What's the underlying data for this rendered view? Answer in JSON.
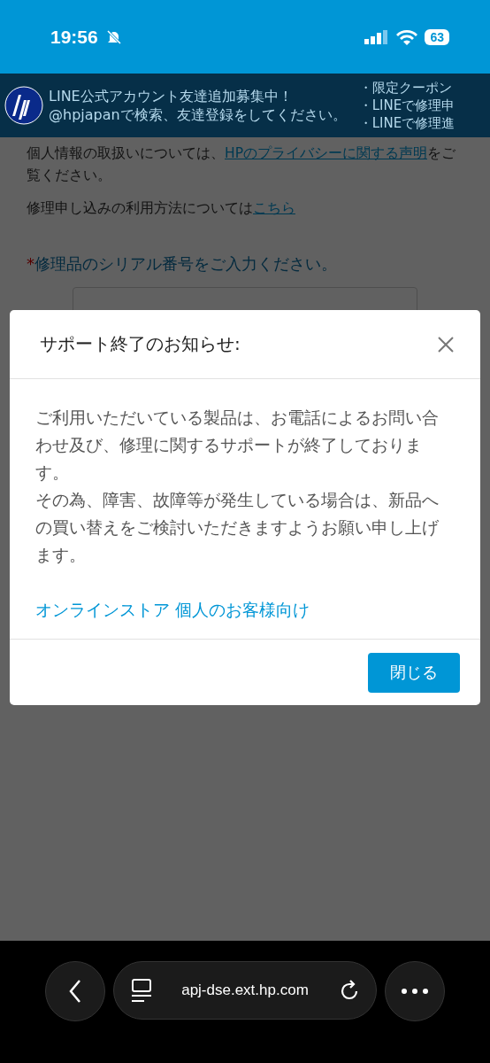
{
  "status_bar": {
    "time": "19:56",
    "battery": "63"
  },
  "banner": {
    "lines": [
      "LINE公式アカウント友達追加募集中！",
      "@hpjapanで検索、友達登録をしてください。"
    ],
    "bullets": [
      "・限定クーポン",
      "・LINEで修理申",
      "・LINEで修理進"
    ]
  },
  "privacy": {
    "before": "個人情報の取扱いについては、",
    "link": "HPのプライバシーに関する声明",
    "after": "をご覧ください。"
  },
  "usage": {
    "text": "修理申し込みの利用方法については",
    "link": "こちら"
  },
  "serial": {
    "required_mark": "*",
    "label": "修理品のシリアル番号をご入力ください。"
  },
  "dialog": {
    "title": "サポート終了のお知らせ:",
    "paragraphs": [
      "ご利用いただいている製品は、お電話によるお問い合わせ及び、修理に関するサポートが終了しております。",
      "その為、障害、故障等が発生している場合は、新品への買い替えをご検討いただきますようお願い申し上げます。"
    ],
    "link": "オンラインストア 個人のお客様向け",
    "close_button": "閉じる"
  },
  "browser_bar": {
    "url": "apj-dse.ext.hp.com"
  }
}
